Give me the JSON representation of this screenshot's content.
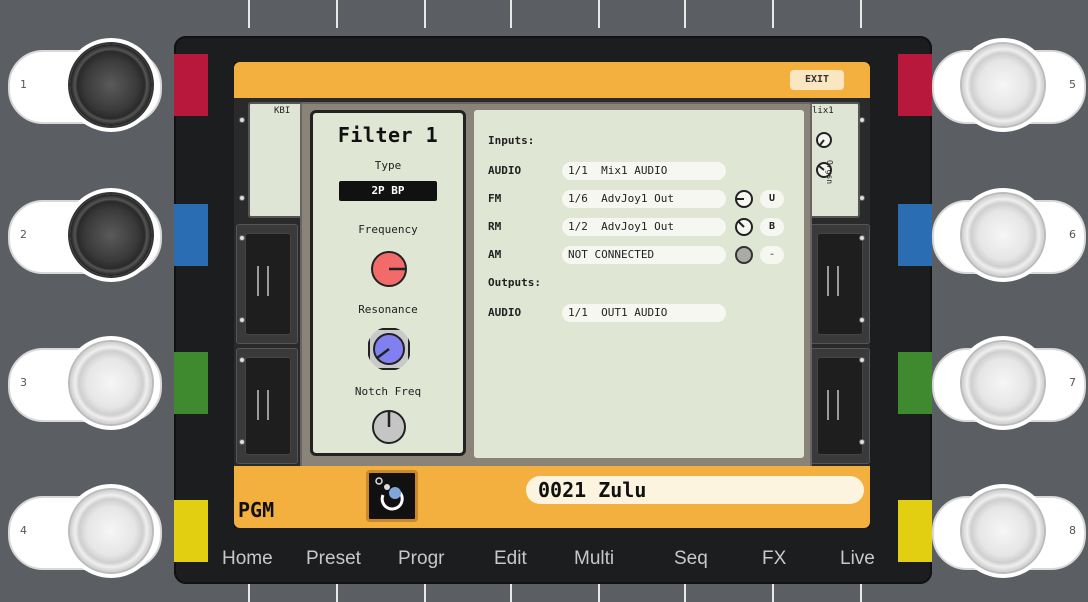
{
  "side_buttons": {
    "left": [
      {
        "num": "1",
        "knob": "dark",
        "tab_color": "#b8183c"
      },
      {
        "num": "2",
        "knob": "dark",
        "tab_color": "#2a6db3"
      },
      {
        "num": "3",
        "knob": "light",
        "tab_color": "#3f8a2e"
      },
      {
        "num": "4",
        "knob": "light",
        "tab_color": "#e2cf12"
      }
    ],
    "right": [
      {
        "num": "5",
        "knob": "light",
        "tab_color": "#b8183c"
      },
      {
        "num": "6",
        "knob": "light",
        "tab_color": "#2a6db3"
      },
      {
        "num": "7",
        "knob": "light",
        "tab_color": "#3f8a2e"
      },
      {
        "num": "8",
        "knob": "light",
        "tab_color": "#e2cf12"
      }
    ]
  },
  "screen": {
    "exit_label": "EXIT",
    "background_modules": {
      "left_card": "KBI",
      "right_card": "lix1",
      "right_card_sub": "Orgsn"
    },
    "filter": {
      "title": "Filter 1",
      "type_label": "Type",
      "type_value": "2P BP",
      "frequency_label": "Frequency",
      "resonance_label": "Resonance",
      "notch_label": "Notch Freq"
    },
    "io": {
      "inputs_label": "Inputs:",
      "inputs": [
        {
          "name": "AUDIO",
          "source": "1/1  Mix1 AUDIO",
          "knob": false,
          "polarity": ""
        },
        {
          "name": "FM",
          "source": "1/6  AdvJoy1 Out",
          "knob": true,
          "polarity": "U"
        },
        {
          "name": "RM",
          "source": "1/2  AdvJoy1 Out",
          "knob": true,
          "polarity": "B"
        },
        {
          "name": "AM",
          "source": "NOT CONNECTED",
          "knob": true,
          "polarity": "-"
        }
      ],
      "outputs_label": "Outputs:",
      "outputs": [
        {
          "name": "AUDIO",
          "dest": "1/1  OUT1 AUDIO"
        }
      ]
    },
    "bottom": {
      "mode_label": "PGM",
      "preset_name": "0021 Zulu"
    }
  },
  "nav": [
    "Home",
    "Preset",
    "Progr",
    "Edit",
    "Multi",
    "Seq",
    "FX",
    "Live"
  ],
  "colors": {
    "screen_accent": "#f3b03f",
    "panel_bg": "#e0e6d4",
    "freq_knob": "#f26a6a",
    "res_knob": "#8080f0"
  }
}
